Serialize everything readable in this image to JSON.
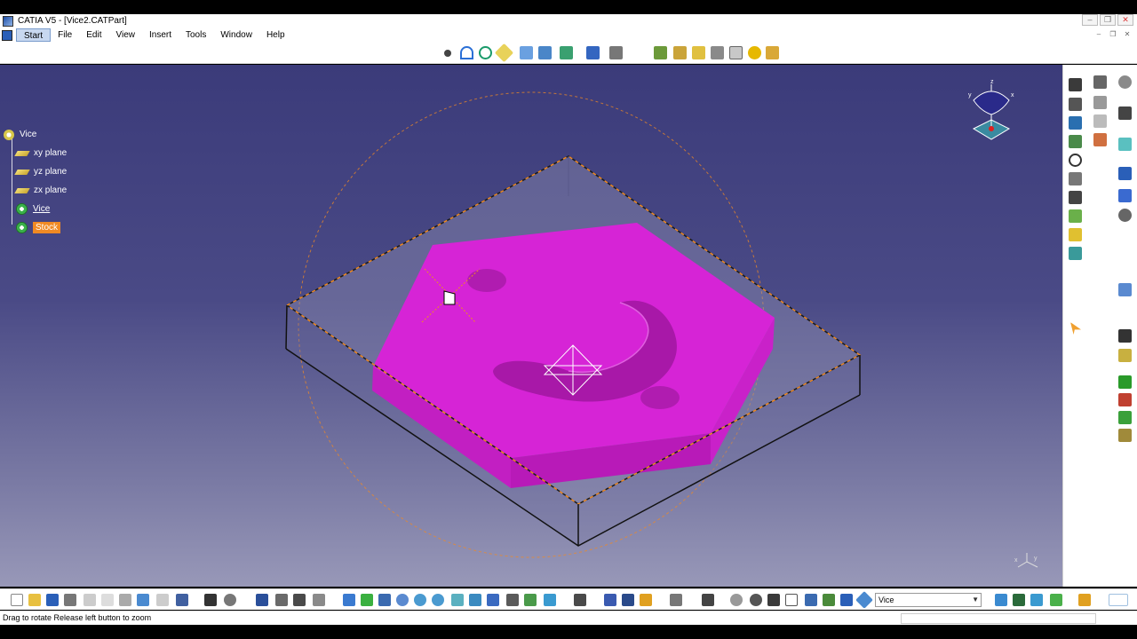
{
  "window": {
    "title": "CATIA V5 - [Vice2.CATPart]"
  },
  "menu": {
    "items": [
      {
        "label": "Start"
      },
      {
        "label": "File"
      },
      {
        "label": "Edit"
      },
      {
        "label": "View"
      },
      {
        "label": "Insert"
      },
      {
        "label": "Tools"
      },
      {
        "label": "Window"
      },
      {
        "label": "Help"
      }
    ]
  },
  "tree": {
    "root": "Vice",
    "planes": [
      "xy plane",
      "yz plane",
      "zx plane"
    ],
    "body_vice": "Vice",
    "body_stock": "Stock"
  },
  "compass_labels": {
    "z": "z",
    "x": "x",
    "y": "y"
  },
  "axis_labels": {
    "x": "x",
    "y": "y"
  },
  "bottom_toolbar": {
    "selector_value": "Vice"
  },
  "status": {
    "text": "Drag to rotate  Release left button to zoom"
  },
  "colors": {
    "part_face": "#d624d6",
    "stock_outline": "#f08a24",
    "viewport_top": "#3b3b7a",
    "viewport_bottom": "#9898b8",
    "selected_item": "#f08a24"
  }
}
